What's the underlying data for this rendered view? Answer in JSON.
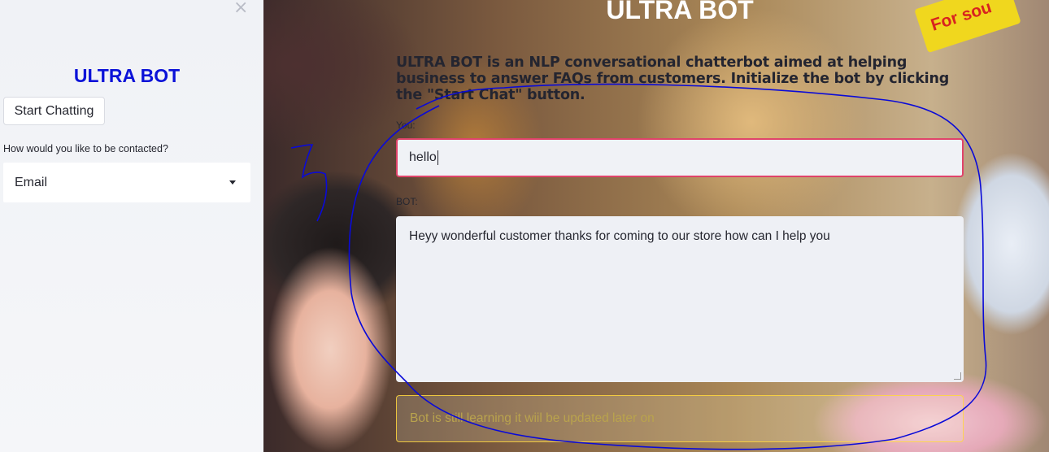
{
  "sidebar": {
    "close_glyph": "×",
    "title": "ULTRA BOT",
    "start_button": "Start Chatting",
    "contact_label": "How would you like to be contacted?",
    "contact_value": "Email"
  },
  "main": {
    "title": "ULTRA BOT",
    "intro": "ULTRA BOT is an NLP conversational chatterbot aimed at helping business to answer FAQs from customers. Initialize the bot by clicking the \"Start Chat\" button.",
    "you_label": "You:",
    "you_value": "hello",
    "bot_label": "BOT:",
    "bot_value": "Heyy wonderful customer thanks for coming to our store how can I help you",
    "warning": "Bot is still learning it wiil be updated later on",
    "sign_text": "For sou"
  },
  "colors": {
    "title_blue": "#0b12d8",
    "input_border": "#e0436a",
    "annotation": "#0a0ad8",
    "warning_border": "#ffd73c"
  }
}
